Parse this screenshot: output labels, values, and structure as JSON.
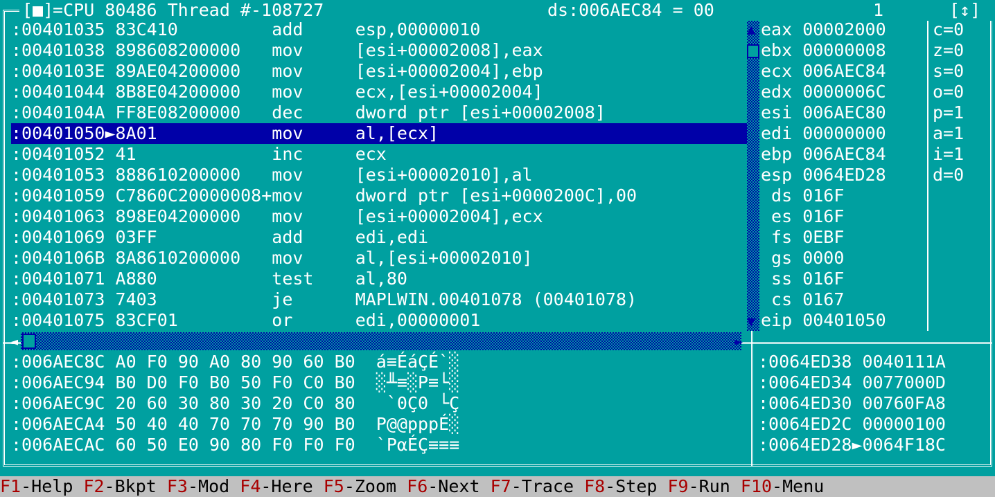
{
  "window": {
    "close_box": "[■]",
    "title": "CPU 80486 Thread #-108727",
    "expr": "ds:006AEC84 = 00",
    "number": "1",
    "zoom_box": "[↕]"
  },
  "disasm": {
    "rows": [
      ":00401035 83C410         add     esp,00000010",
      ":00401038 898608200000   mov     [esi+00002008],eax",
      ":0040103E 89AE04200000   mov     [esi+00002004],ebp",
      ":00401044 8B8E04200000   mov     ecx,[esi+00002004]",
      ":0040104A FF8E08200000   dec     dword ptr [esi+00002008]",
      ":00401050►8A01           mov     al,[ecx]",
      ":00401052 41             inc     ecx",
      ":00401053 888610200000   mov     [esi+00002010],al",
      ":00401059 C7860C20000008+mov     dword ptr [esi+0000200C],00",
      ":00401063 898E04200000   mov     [esi+00002004],ecx",
      ":00401069 03FF           add     edi,edi",
      ":0040106B 8A8610200000   mov     al,[esi+00002010]",
      ":00401071 A880           test    al,80",
      ":00401073 7403           je      MAPLWIN.00401078 (00401078)",
      ":00401075 83CF01         or      edi,00000001"
    ],
    "current_index": 5
  },
  "registers": [
    "eax 00002000",
    "ebx 00000008",
    "ecx 006AEC84",
    "edx 0000006C",
    "esi 006AEC80",
    "edi 00000000",
    "ebp 006AEC84",
    "esp 0064ED28",
    " ds 016F",
    " es 016F",
    " fs 0EBF",
    " gs 0000",
    " ss 016F",
    " cs 0167",
    "eip 00401050"
  ],
  "flags": [
    "c=0",
    "z=0",
    "s=0",
    "o=0",
    "p=1",
    "a=1",
    "i=1",
    "d=0"
  ],
  "dump": [
    ":006AEC8C A0 F0 90 A0 80 90 60 B0  á≡ÉáÇÉ`░",
    ":006AEC94 B0 D0 F0 B0 50 F0 C0 B0  ░╨≡░P≡└░",
    ":006AEC9C 20 60 30 80 30 20 C0 80   `0Ç0 └Ç",
    ":006AECA4 50 40 40 70 70 70 90 B0  P@@pppÉ░",
    ":006AECAC 60 50 E0 90 80 F0 F0 F0  `PαÉÇ≡≡≡"
  ],
  "stack": [
    ":0064ED38 0040111A",
    ":0064ED34 0077000D",
    ":0064ED30 00760FA8",
    ":0064ED2C 00000100",
    ":0064ED28►0064F18C"
  ],
  "fkeys": [
    {
      "key": "F1",
      "label": "-Help"
    },
    {
      "key": "F2",
      "label": "-Bkpt"
    },
    {
      "key": "F3",
      "label": "-Mod"
    },
    {
      "key": "F4",
      "label": "-Here"
    },
    {
      "key": "F5",
      "label": "-Zoom"
    },
    {
      "key": "F6",
      "label": "-Next"
    },
    {
      "key": "F7",
      "label": "-Trace"
    },
    {
      "key": "F8",
      "label": "-Step"
    },
    {
      "key": "F9",
      "label": "-Run"
    },
    {
      "key": "F10",
      "label": "-Menu"
    }
  ],
  "colors": {
    "background": "#00A0A0",
    "highlight": "#0000A8",
    "fkey": "#A80000",
    "statusbar": "#C0C0C0"
  }
}
